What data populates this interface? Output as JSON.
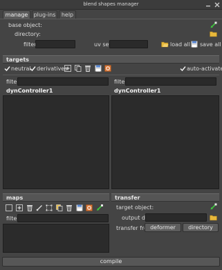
{
  "window": {
    "title": "blend shapes manager"
  },
  "tabs": [
    {
      "label": "manage"
    },
    {
      "label": "plug-ins"
    },
    {
      "label": "help"
    }
  ],
  "manage": {
    "base_object_label": "base object:",
    "directory_label": "directory:",
    "filter_label": "filter:",
    "filter_value": "",
    "uv_set_label": "uv set:",
    "uv_set_value": "",
    "load_all_label": "load all",
    "save_all_label": "save all"
  },
  "targets": {
    "header": "targets",
    "neutral_label": "neutral",
    "derivatives_label": "derivatives",
    "auto_activate_label": "auto-activate",
    "neutral_checked": true,
    "derivatives_checked": true,
    "auto_activate_checked": true,
    "left": {
      "filter_label": "filter:",
      "filter_value": "",
      "title": "dynController1"
    },
    "right": {
      "filter_label": "filter:",
      "filter_value": "",
      "title": "dynController1"
    }
  },
  "maps": {
    "header": "maps",
    "filter_label": "filter:",
    "filter_value": ""
  },
  "transfer": {
    "header": "transfer",
    "target_object_label": "target object:",
    "output_dir_label": "output dir:",
    "output_dir_value": "",
    "transfer_from_label": "transfer from:",
    "deformer_label": "deformer",
    "directory_button_label": "directory"
  },
  "footer": {
    "compile_label": "compile"
  },
  "icons": {
    "window_controls": [
      "minimize-icon",
      "close-icon"
    ],
    "targets_toolbar": [
      "add-icon",
      "copy-icon",
      "delete-icon",
      "save-icon",
      "reset-icon"
    ],
    "maps_toolbar": [
      "new-icon",
      "add-icon",
      "delete-icon",
      "paint-icon",
      "select-icon",
      "copy-icon",
      "delete-icon",
      "save-icon",
      "reset-icon",
      "load-icon"
    ]
  },
  "colors": {
    "background": "#444444",
    "panel": "#2b2b2b",
    "header": "#555555",
    "accent_green": "#3fc93f"
  }
}
